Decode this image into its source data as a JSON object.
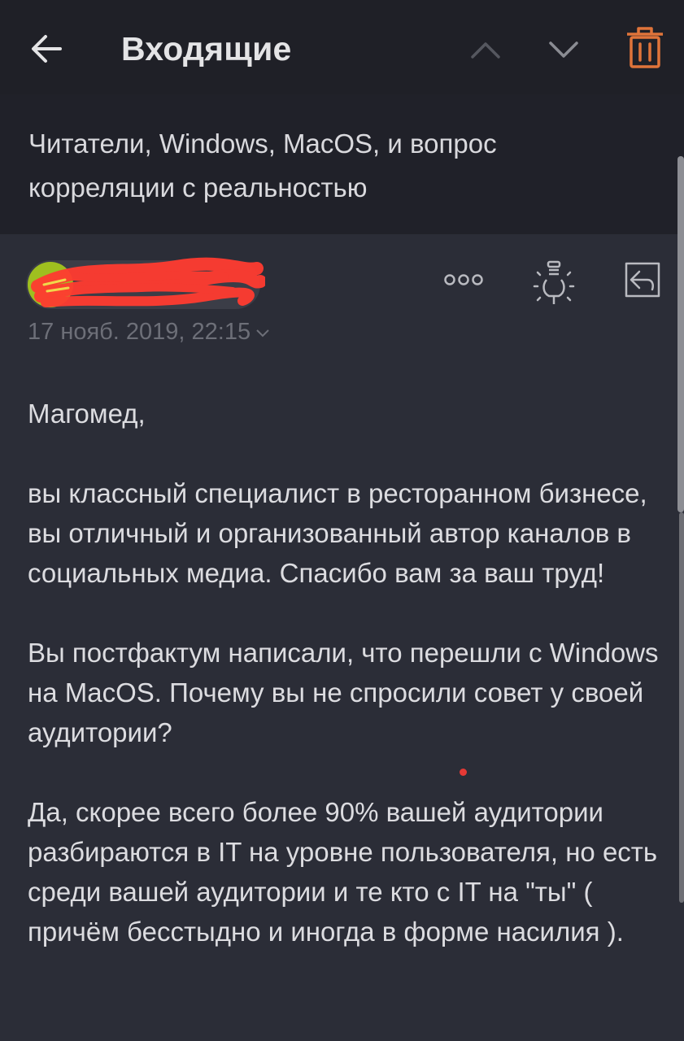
{
  "header": {
    "title": "Входящие",
    "icons": [
      "back-arrow-icon",
      "chevron-up-icon",
      "chevron-down-icon",
      "trash-icon"
    ],
    "trash_color": "#e0743a"
  },
  "message": {
    "subject": "Читатели, Windows, MacOS, и вопрос корреляции с реальностью",
    "sender_redacted": true,
    "date": "17 нояб. 2019, 22:15",
    "actions": [
      "more-icon",
      "lightbulb-icon",
      "reply-icon"
    ],
    "body": [
      "Магомед,",
      "вы классный специалист в ресторанном бизнесе, вы отличный и организованный автор каналов в социальных медиа. Спасибо вам за ваш труд!",
      "Вы постфактум написали, что перешли с Windows на MacOS. Почему вы не спросили совет у своей аудитории?",
      "Да, скорее всего более 90% вашей аудитории разбираются в IT на уровне пользователя, но есть среди вашей аудитории и те кто с IT на \"ты\" ( причём бесстыдно и иногда в форме насилия )."
    ]
  },
  "colors": {
    "background": "#2b2d37",
    "topbar": "#1f2027",
    "subject_bar": "#202129",
    "text": "#dcdce0",
    "muted": "#6d6f78",
    "avatar": "#9fbf1f",
    "redaction": "#ff3b30"
  }
}
